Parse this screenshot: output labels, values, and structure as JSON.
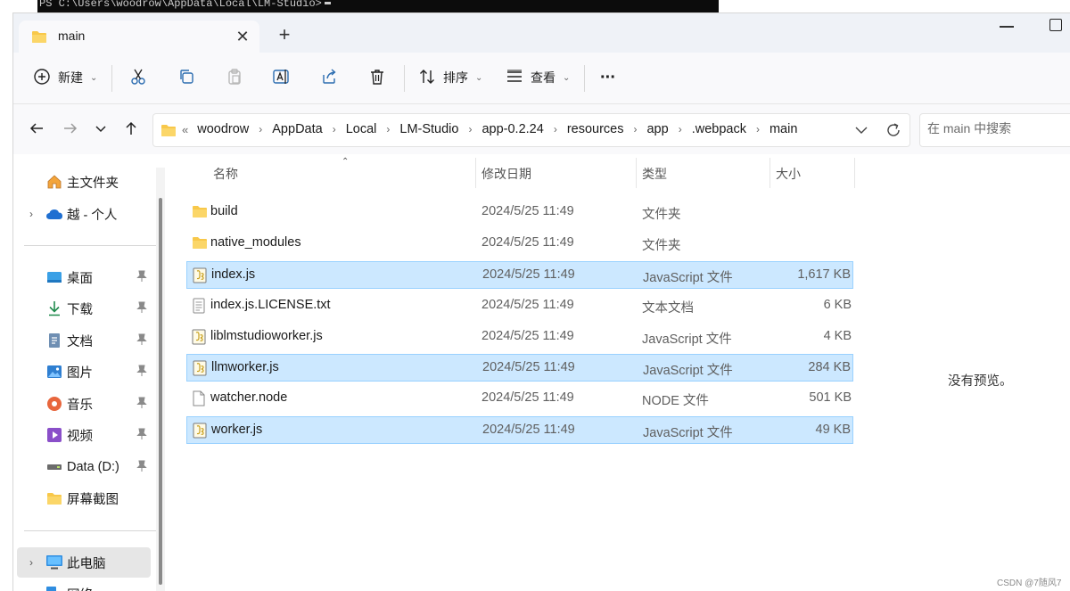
{
  "terminal": {
    "text": "PS C:\\Users\\woodrow\\AppData\\Local\\LM-Studio>"
  },
  "tab": {
    "title": "main",
    "close": "✕",
    "add": "+"
  },
  "toolbar": {
    "new_label": "新建",
    "sort_label": "排序",
    "view_label": "查看",
    "more": "···"
  },
  "address": {
    "overflow": "«",
    "crumbs": [
      "woodrow",
      "AppData",
      "Local",
      "LM-Studio",
      "app-0.2.24",
      "resources",
      "app",
      ".webpack",
      "main"
    ],
    "separator": "›"
  },
  "search": {
    "placeholder": "在 main 中搜索"
  },
  "sidebar": {
    "home": "主文件夹",
    "cloud": "越 - 个人",
    "quick": [
      {
        "label": "桌面",
        "icon": "desktop-icon"
      },
      {
        "label": "下载",
        "icon": "download-icon"
      },
      {
        "label": "文档",
        "icon": "document-icon"
      },
      {
        "label": "图片",
        "icon": "picture-icon"
      },
      {
        "label": "音乐",
        "icon": "music-icon"
      },
      {
        "label": "视频",
        "icon": "video-icon"
      },
      {
        "label": "Data (D:)",
        "icon": "drive-icon"
      },
      {
        "label": "屏幕截图",
        "icon": "folder-icon"
      }
    ],
    "this_pc": "此电脑",
    "network": "网络"
  },
  "columns": {
    "name": "名称",
    "date": "修改日期",
    "type": "类型",
    "size": "大小"
  },
  "files": [
    {
      "name": "build",
      "date": "2024/5/25 11:49",
      "type": "文件夹",
      "size": "",
      "icon": "folder-icon",
      "selected": false
    },
    {
      "name": "native_modules",
      "date": "2024/5/25 11:49",
      "type": "文件夹",
      "size": "",
      "icon": "folder-icon",
      "selected": false
    },
    {
      "name": "index.js",
      "date": "2024/5/25 11:49",
      "type": "JavaScript 文件",
      "size": "1,617 KB",
      "icon": "js-file-icon",
      "selected": true
    },
    {
      "name": "index.js.LICENSE.txt",
      "date": "2024/5/25 11:49",
      "type": "文本文档",
      "size": "6 KB",
      "icon": "text-file-icon",
      "selected": false
    },
    {
      "name": "liblmstudioworker.js",
      "date": "2024/5/25 11:49",
      "type": "JavaScript 文件",
      "size": "4 KB",
      "icon": "js-file-icon",
      "selected": false
    },
    {
      "name": "llmworker.js",
      "date": "2024/5/25 11:49",
      "type": "JavaScript 文件",
      "size": "284 KB",
      "icon": "js-file-icon",
      "selected": true
    },
    {
      "name": "watcher.node",
      "date": "2024/5/25 11:49",
      "type": "NODE 文件",
      "size": "501 KB",
      "icon": "blank-file-icon",
      "selected": false
    },
    {
      "name": "worker.js",
      "date": "2024/5/25 11:49",
      "type": "JavaScript 文件",
      "size": "49 KB",
      "icon": "js-file-icon",
      "selected": true
    }
  ],
  "preview": {
    "empty_text": "没有预览。"
  },
  "watermark": "CSDN @7随风7",
  "colors": {
    "selection": "#cce8ff",
    "selection_border": "#99d1ff",
    "folder": "#f8c84a",
    "tabbar": "#eff2f7"
  }
}
